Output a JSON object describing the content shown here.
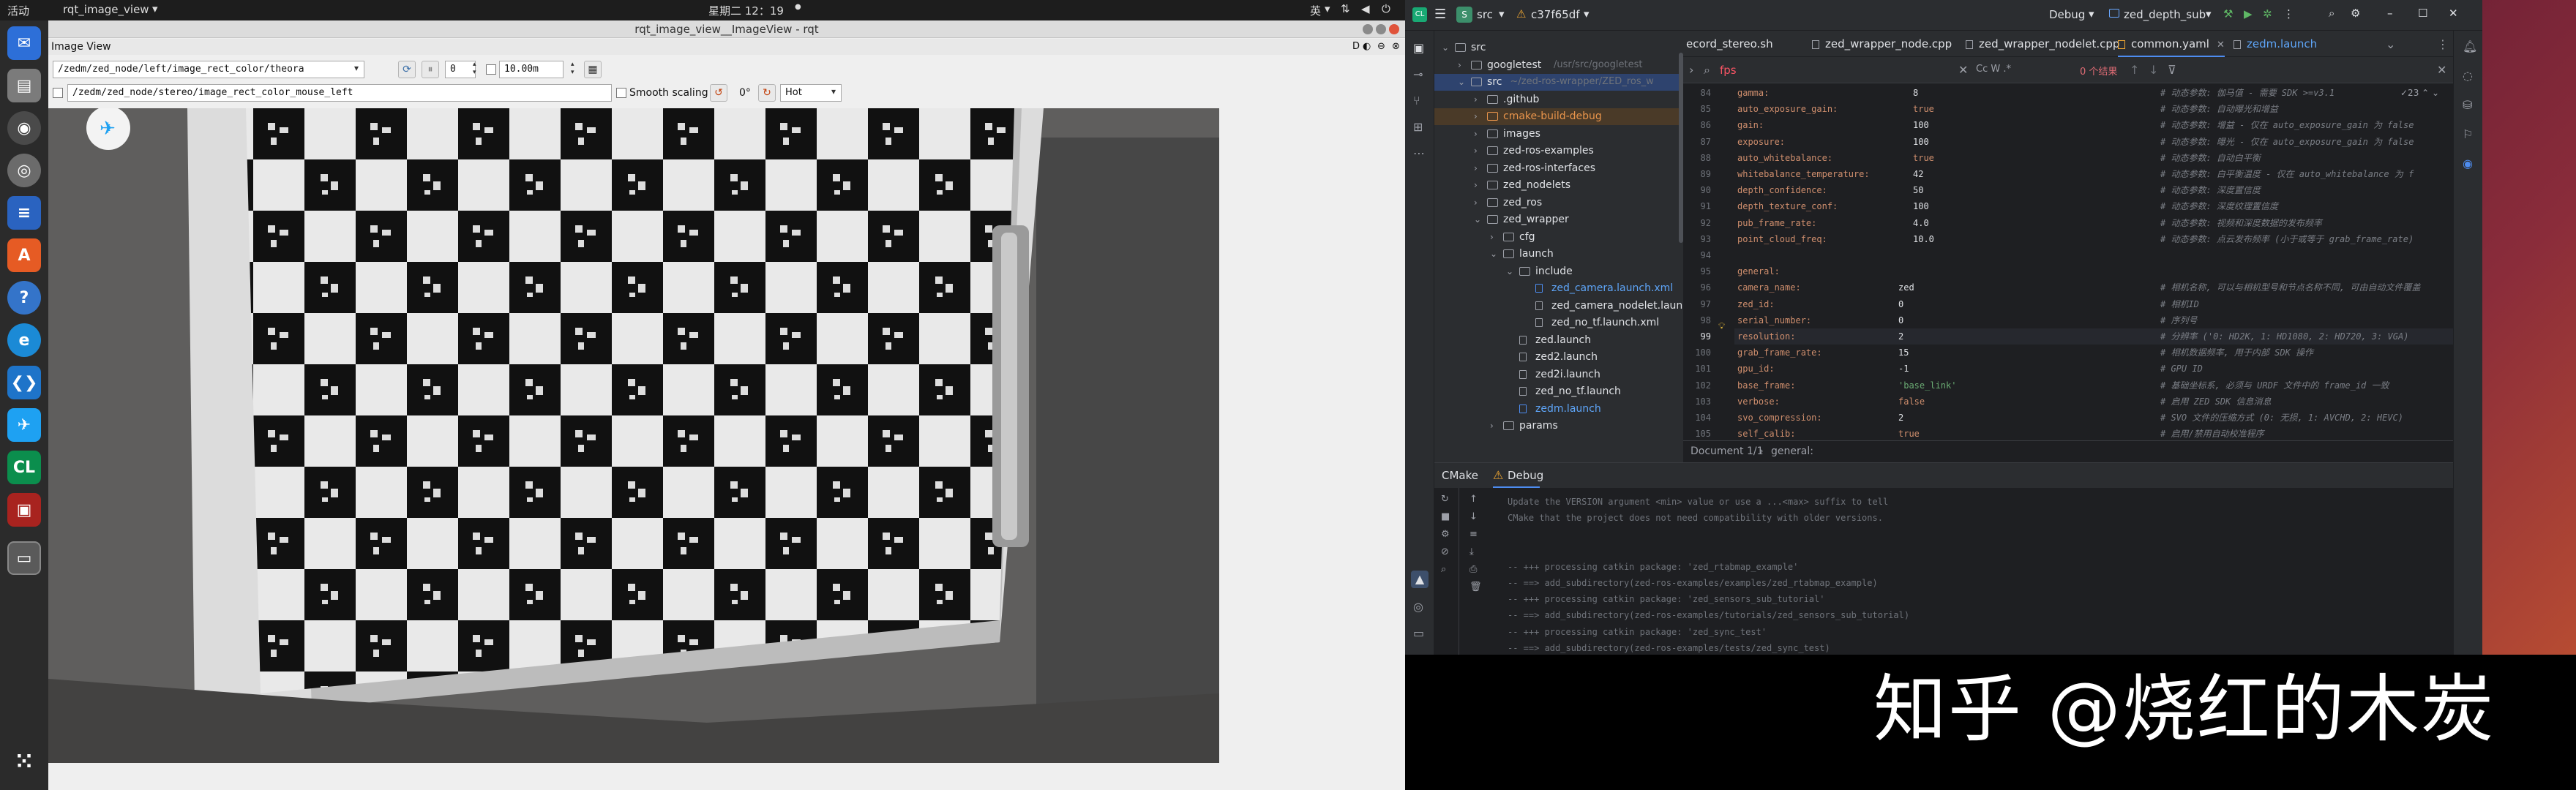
{
  "topbar": {
    "activities": "活动",
    "app_name": "rqt_image_view",
    "clock": "星期二 12：19",
    "input_method": "英"
  },
  "rqt": {
    "window_title": "rqt_image_view__ImageView - rqt",
    "plugin_title": "Image View",
    "plugin_controls": "D",
    "topic": "/zedm/zed_node/left/image_rect_color/theora",
    "spin_value": "0",
    "zoom_value": "10.00m",
    "mouse_topic": "/zedm/zed_node/stereo/image_rect_color_mouse_left",
    "smooth_scaling_label": "Smooth scaling",
    "rotation_label": "0°",
    "colormap_value": "Hot"
  },
  "ide": {
    "project_label": "src",
    "vcs_commit": "c37f65df",
    "run_config": "Debug",
    "target": "zed_depth_sub",
    "tabs": [
      "ecord_stereo.sh",
      "zed_wrapper_node.cpp",
      "zed_wrapper_nodelet.cpp",
      "common.yaml",
      "zedm.launch"
    ],
    "active_tab": "common.yaml",
    "find_query": "fps",
    "find_result": "0 个结果",
    "find_options": "Cc W .*",
    "tree": [
      {
        "label": "src",
        "indent": 0,
        "kind": "folder",
        "open": true
      },
      {
        "label": "googletest",
        "note": "/usr/src/googletest",
        "indent": 1,
        "kind": "folder"
      },
      {
        "label": "src",
        "note": "~/zed-ros-wrapper/ZED_ros_w",
        "indent": 1,
        "kind": "folder",
        "open": true
      },
      {
        "label": ".github",
        "indent": 2,
        "kind": "folder"
      },
      {
        "label": "cmake-build-debug",
        "indent": 2,
        "kind": "folder-orange"
      },
      {
        "label": "images",
        "indent": 2,
        "kind": "folder"
      },
      {
        "label": "zed-ros-examples",
        "indent": 2,
        "kind": "folder"
      },
      {
        "label": "zed-ros-interfaces",
        "indent": 2,
        "kind": "folder"
      },
      {
        "label": "zed_nodelets",
        "indent": 2,
        "kind": "folder"
      },
      {
        "label": "zed_ros",
        "indent": 2,
        "kind": "folder"
      },
      {
        "label": "zed_wrapper",
        "indent": 2,
        "kind": "folder",
        "open": true
      },
      {
        "label": "cfg",
        "indent": 3,
        "kind": "folder"
      },
      {
        "label": "launch",
        "indent": 3,
        "kind": "folder",
        "open": true
      },
      {
        "label": "include",
        "indent": 4,
        "kind": "folder",
        "open": true
      },
      {
        "label": "zed_camera.launch.xml",
        "indent": 5,
        "kind": "file-blue"
      },
      {
        "label": "zed_camera_nodelet.launch",
        "indent": 5,
        "kind": "file"
      },
      {
        "label": "zed_no_tf.launch.xml",
        "indent": 5,
        "kind": "file"
      },
      {
        "label": "zed.launch",
        "indent": 4,
        "kind": "file"
      },
      {
        "label": "zed2.launch",
        "indent": 4,
        "kind": "file"
      },
      {
        "label": "zed2i.launch",
        "indent": 4,
        "kind": "file"
      },
      {
        "label": "zed_no_tf.launch",
        "indent": 4,
        "kind": "file"
      },
      {
        "label": "zedm.launch",
        "indent": 4,
        "kind": "file-blue"
      },
      {
        "label": "params",
        "indent": 3,
        "kind": "folder"
      }
    ],
    "code": [
      {
        "n": "84",
        "k": "    gamma:",
        "v": "8",
        "c": "# 动态参数: 伽马值 - 需要 SDK >=v3.1"
      },
      {
        "n": "85",
        "k": "    auto_exposure_gain:",
        "v": "true",
        "c": "# 动态参数: 自动曝光和增益"
      },
      {
        "n": "86",
        "k": "    gain:",
        "v": "100",
        "c": "# 动态参数: 增益 - 仅在 auto_exposure_gain 为 false"
      },
      {
        "n": "87",
        "k": "    exposure:",
        "v": "100",
        "c": "# 动态参数: 曝光 - 仅在 auto_exposure_gain 为 false"
      },
      {
        "n": "88",
        "k": "    auto_whitebalance:",
        "v": "true",
        "c": "# 动态参数: 自动白平衡"
      },
      {
        "n": "89",
        "k": "    whitebalance_temperature:",
        "v": "42",
        "c": "# 动态参数: 白平衡温度 - 仅在 auto_whitebalance 为 f"
      },
      {
        "n": "90",
        "k": "    depth_confidence:",
        "v": "50",
        "c": "# 动态参数: 深度置信度"
      },
      {
        "n": "91",
        "k": "    depth_texture_conf:",
        "v": "100",
        "c": "# 动态参数: 深度纹理置信度"
      },
      {
        "n": "92",
        "k": "    pub_frame_rate:",
        "v": "4.0",
        "c": "# 动态参数: 视频和深度数据的发布频率"
      },
      {
        "n": "93",
        "k": "    point_cloud_freq:",
        "v": "10.0",
        "c": "# 动态参数: 点云发布频率 (小于或等于 grab_frame_rate)"
      },
      {
        "n": "94",
        "k": "",
        "v": "",
        "c": ""
      },
      {
        "n": "95",
        "k": "general:",
        "v": "",
        "c": ""
      },
      {
        "n": "96",
        "k": "    camera_name:",
        "v": "zed",
        "c": "# 相机名称, 可以与相机型号和节点名称不同, 可由自动文件覆盖"
      },
      {
        "n": "97",
        "k": "    zed_id:",
        "v": "0",
        "c": "# 相机ID"
      },
      {
        "n": "98",
        "k": "    serial_number:",
        "v": "0",
        "c": "# 序列号"
      },
      {
        "n": "99",
        "k": "    resolution:",
        "v": "2",
        "c": "# 分辨率 ('0: HD2K, 1: HD1080, 2: HD720, 3: VGA)"
      },
      {
        "n": "100",
        "k": "    grab_frame_rate:",
        "v": "15",
        "c": "# 相机数据频率, 用于内部 SDK 操作"
      },
      {
        "n": "101",
        "k": "    gpu_id:",
        "v": "-1",
        "c": "# GPU ID"
      },
      {
        "n": "102",
        "k": "    base_frame:",
        "v": "'base_link'",
        "c": "# 基础坐标系, 必须与 URDF 文件中的 frame_id 一致"
      },
      {
        "n": "103",
        "k": "    verbose:",
        "v": "false",
        "c": "# 启用 ZED SDK 信息消息"
      },
      {
        "n": "104",
        "k": "    svo_compression:",
        "v": "2",
        "c": "# SVO 文件的压缩方式 (0: 无损, 1: AVCHD, 2: HEVC)"
      },
      {
        "n": "105",
        "k": "    self_calib:",
        "v": "true",
        "c": "# 启用/禁用自动校准程序"
      }
    ],
    "breadcrumb": "Document 1/1",
    "breadcrumb_node": "general:",
    "bottom_tabs": [
      "CMake",
      "Debug"
    ],
    "console": [
      "Update the VERSION argument <min> value or use a ...<max> suffix to tell",
      "CMake that the project does not need compatibility with older versions.",
      "",
      "",
      "-- +++ processing catkin package: 'zed_rtabmap_example'",
      "-- ==> add_subdirectory(zed-ros-examples/examples/zed_rtabmap_example)",
      "-- +++ processing catkin package: 'zed_sensors_sub_tutorial'",
      "-- ==> add_subdirectory(zed-ros-examples/tutorials/zed_sensors_sub_tutorial)",
      "-- +++ processing catkin package: 'zed_sync_test'",
      "-- ==> add_subdirectory(zed-ros-examples/tests/zed_sync_test)"
    ]
  },
  "watermark": "知乎 @烧红的木炭"
}
